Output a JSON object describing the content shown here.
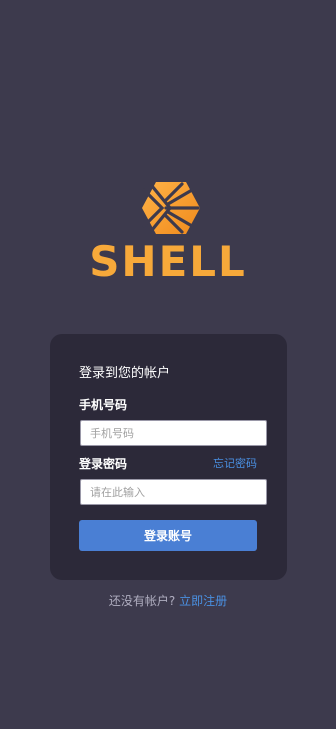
{
  "brand": {
    "logo_text": "SHELL",
    "color": "#f7a93a"
  },
  "login_card": {
    "title": "登录到您的帐户",
    "phone": {
      "label": "手机号码",
      "placeholder": "手机号码",
      "value": ""
    },
    "password": {
      "label": "登录密码",
      "placeholder": "请在此输入",
      "value": "",
      "forgot_label": "忘记密码"
    },
    "submit_label": "登录账号"
  },
  "register": {
    "prompt": "还没有帐户?",
    "link_label": "立即注册"
  },
  "colors": {
    "background": "#3d3a4d",
    "card": "#2c2939",
    "accent": "#4a7fd4",
    "link": "#4a90e2"
  }
}
